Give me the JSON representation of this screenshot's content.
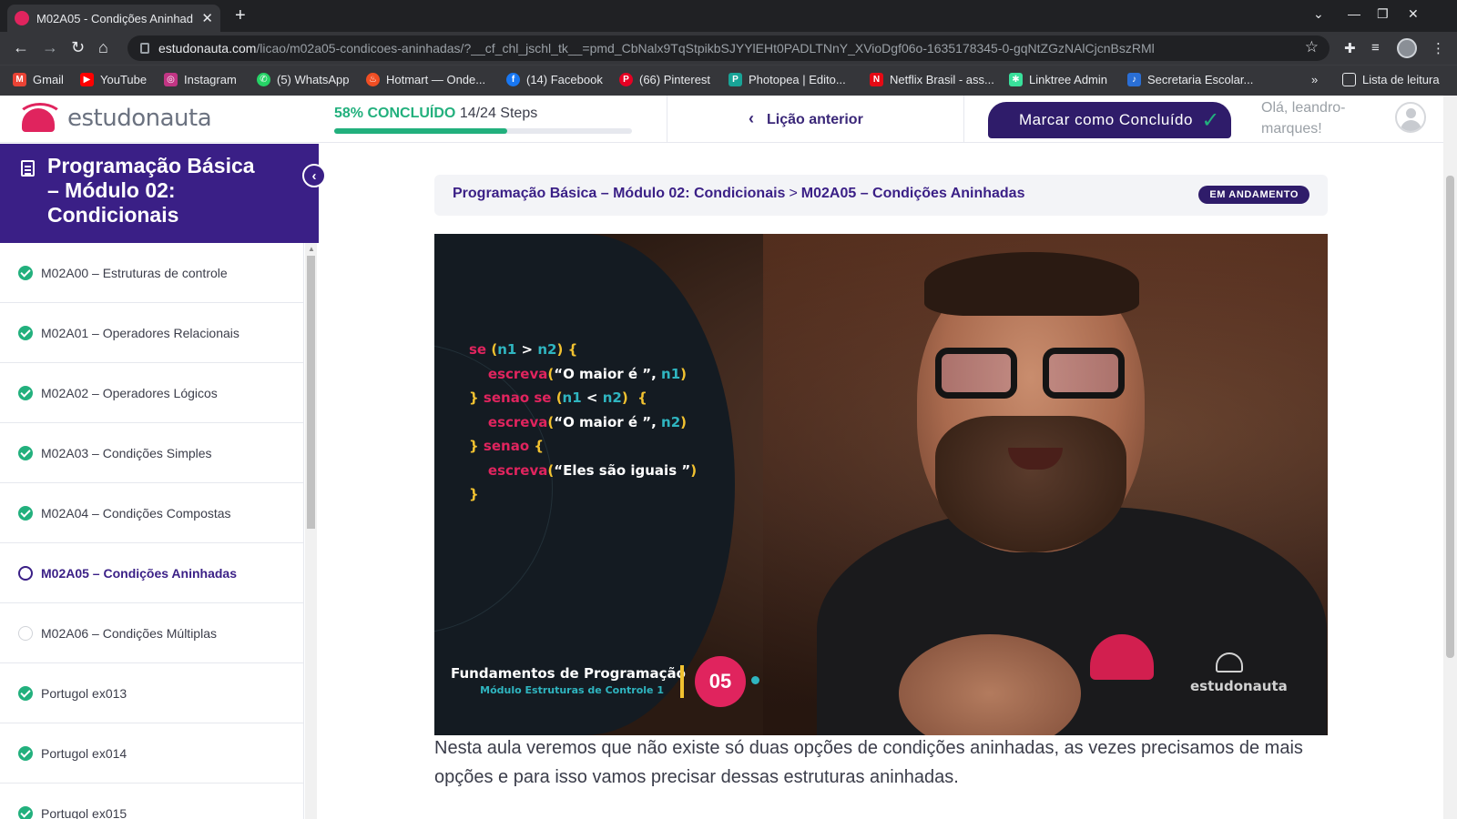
{
  "browser": {
    "tab_title": "M02A05 - Condições Aninhad",
    "url_host": "estudonauta.com",
    "url_path": "/licao/m02a05-condicoes-aninhadas/?__cf_chl_jschl_tk__=pmd_CbNalx9TqStpikbSJYYlEHt0PADLTNnY_XVioDgf06o-1635178345-0-gqNtZGzNAlCjcnBszRMl",
    "bookmarks": [
      {
        "label": "Gmail",
        "color": "#ea4335",
        "glyph": "M"
      },
      {
        "label": "YouTube",
        "color": "#ff0000",
        "glyph": "▶"
      },
      {
        "label": "Instagram",
        "color": "#c13584",
        "glyph": "◎"
      },
      {
        "label": "(5) WhatsApp",
        "color": "#25d366",
        "glyph": "✆"
      },
      {
        "label": "Hotmart — Onde...",
        "color": "#f04e23",
        "glyph": "♨"
      },
      {
        "label": "(14) Facebook",
        "color": "#1877f2",
        "glyph": "f"
      },
      {
        "label": "(66) Pinterest",
        "color": "#e60023",
        "glyph": "P"
      },
      {
        "label": "Photopea | Edito...",
        "color": "#18a497",
        "glyph": "P"
      },
      {
        "label": "Netflix Brasil - ass...",
        "color": "#e50914",
        "glyph": "N"
      },
      {
        "label": "Linktree Admin",
        "color": "#39e09b",
        "glyph": "✱"
      },
      {
        "label": "Secretaria Escolar...",
        "color": "#2a6fd6",
        "glyph": "♪"
      }
    ],
    "reading_list": "Lista de leitura"
  },
  "header": {
    "logo_text": "estudonauta",
    "progress_percent_label": "58% CONCLUÍDO",
    "progress_steps": "14/24 Steps",
    "progress_fraction": 0.58,
    "prev_lesson": "Lição anterior",
    "mark_complete": "Marcar como Concluído",
    "greeting": "Olá, leandro-marques!"
  },
  "sidebar": {
    "course_title": "Programação Básica – Módulo 02: Condicionais",
    "lessons": [
      {
        "label": "M02A00 – Estruturas de controle",
        "status": "done"
      },
      {
        "label": "M02A01 – Operadores Relacionais",
        "status": "done"
      },
      {
        "label": "M02A02 – Operadores Lógicos",
        "status": "done"
      },
      {
        "label": "M02A03 – Condições Simples",
        "status": "done"
      },
      {
        "label": "M02A04 – Condições Compostas",
        "status": "done"
      },
      {
        "label": "M02A05 – Condições Aninhadas",
        "status": "current"
      },
      {
        "label": "M02A06 – Condições Múltiplas",
        "status": "todo"
      },
      {
        "label": "Portugol ex013",
        "status": "done"
      },
      {
        "label": "Portugol ex014",
        "status": "done"
      },
      {
        "label": "Portugol ex015",
        "status": "done"
      }
    ]
  },
  "main": {
    "breadcrumb_course": "Programação Básica – Módulo 02: Condicionais",
    "breadcrumb_sep": ">",
    "breadcrumb_lesson": "M02A05 – Condições Aninhadas",
    "status_badge": "EM ANDAMENTO",
    "video": {
      "title": "Fundamentos de Programação",
      "subtitle": "Módulo Estruturas de Controle 1",
      "episode": "05",
      "watermark": "estudonauta"
    },
    "description": "Nesta aula veremos que não existe só duas opções de condições aninhadas, as vezes precisamos de mais opções e para isso vamos precisar dessas estruturas aninhadas."
  },
  "colors": {
    "brand_purple": "#3a1f86",
    "brand_pink": "#e0245e",
    "success_green": "#22b07d"
  }
}
